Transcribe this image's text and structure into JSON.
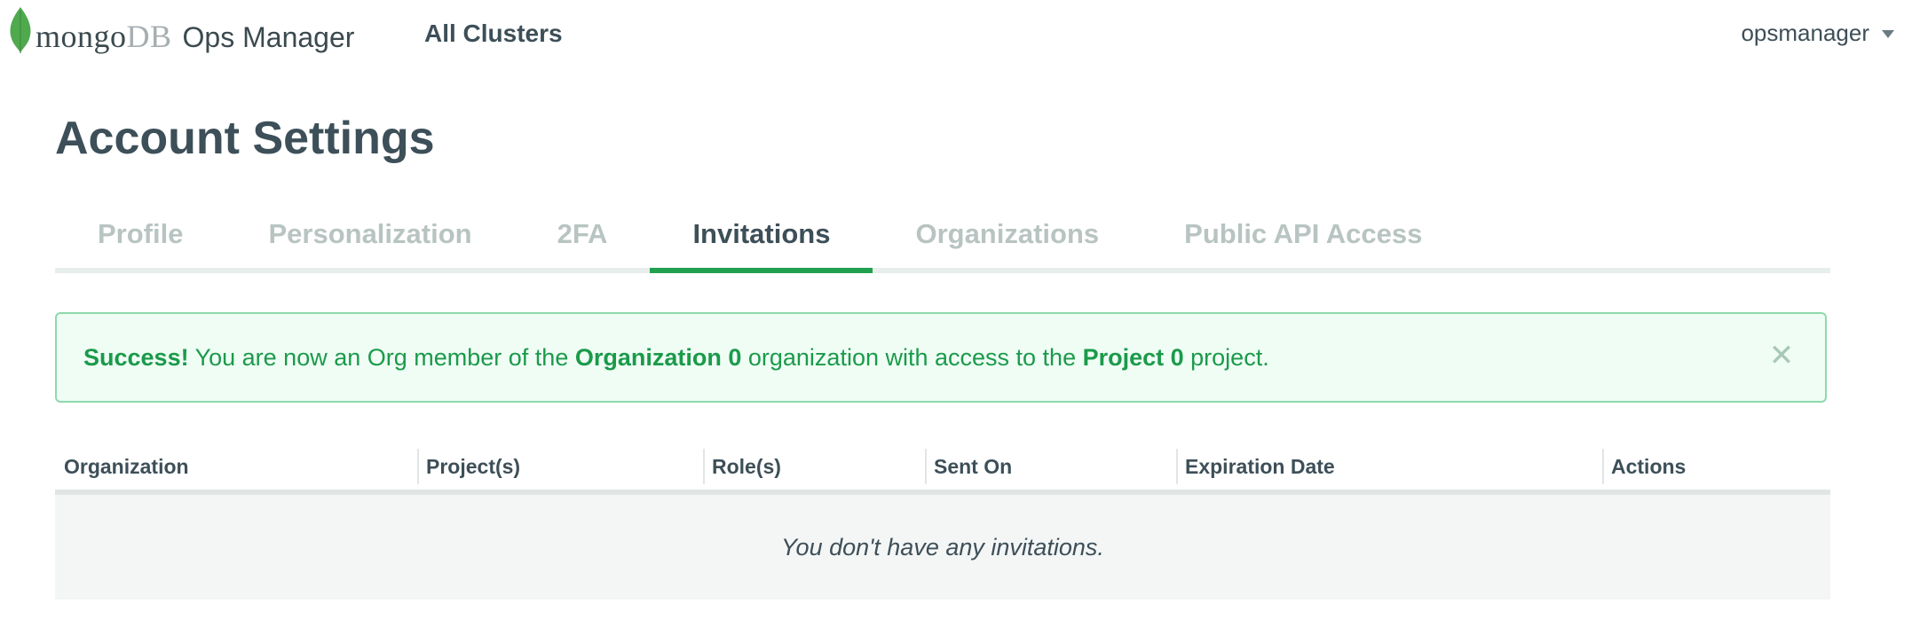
{
  "header": {
    "logo": {
      "mongo": "mongo",
      "db": "DB",
      "product": "Ops Manager"
    },
    "nav_link": "All Clusters",
    "user_menu": {
      "username": "opsmanager"
    }
  },
  "page": {
    "title": "Account Settings",
    "tabs": [
      {
        "label": "Profile",
        "active": false
      },
      {
        "label": "Personalization",
        "active": false
      },
      {
        "label": "2FA",
        "active": false
      },
      {
        "label": "Invitations",
        "active": true
      },
      {
        "label": "Organizations",
        "active": false
      },
      {
        "label": "Public API Access",
        "active": false
      }
    ]
  },
  "alert": {
    "prefix": "Success!",
    "text1": " You are now an Org member of the ",
    "organization": "Organization 0",
    "text2": " organization with access to the ",
    "project": "Project 0",
    "text3": " project.",
    "close_icon": "close-icon"
  },
  "table": {
    "columns": [
      "Organization",
      "Project(s)",
      "Role(s)",
      "Sent On",
      "Expiration Date",
      "Actions"
    ],
    "empty_message": "You don't have any invitations."
  },
  "colors": {
    "accent": "#21a04f",
    "alert_bg": "#effdf5",
    "alert_border": "#8ed9ab",
    "text": "#3d4f58",
    "tab_inactive": "#b8c4c2"
  }
}
